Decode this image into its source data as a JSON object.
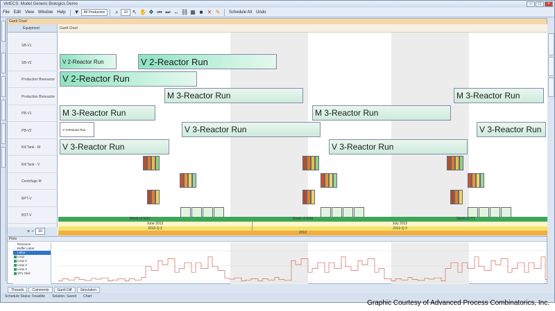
{
  "window": {
    "title": "VirtECS: Model Generic Biologics Demo"
  },
  "menu": {
    "items": [
      "File",
      "Edit",
      "View",
      "Window",
      "Help"
    ],
    "view_selector": "All Production",
    "zoom_value": "10",
    "schedule_label": "Schedule All",
    "undo_label": "Undo"
  },
  "left_tabs": [
    "Project",
    "Recipes",
    "Orders",
    "Models",
    "Data Sets",
    "Assumptions",
    "Scenarios",
    "Attribute Set"
  ],
  "right_tabs": [
    "History",
    "Tasks Detail",
    "Properties"
  ],
  "gantt": {
    "panel_title": "Gantt Chart",
    "equipment_header": "Equipment",
    "chart_header": "Gantt Chart",
    "equipment": [
      "SB-V1",
      "SB-V2",
      "Production Bioreactor",
      "Production Bioreactor",
      "PB-V1",
      "PB-V2",
      "Kill Tank - M",
      "Kill Tank - V",
      "Centrifuge M",
      "BPT-V",
      "BST-V"
    ],
    "bars": [
      {
        "label": "V 2-Reactor Run",
        "size": "small",
        "kind": "dark"
      },
      {
        "label": "V 2-Reactor Run",
        "size": "large",
        "kind": "dark"
      },
      {
        "label": "V 2-Reactor Run",
        "size": "large",
        "kind": "dark"
      },
      {
        "label": "M 3-Reactor Run",
        "size": "large",
        "kind": "light"
      },
      {
        "label": "M 3-Reactor Run",
        "size": "large",
        "kind": "light"
      },
      {
        "label": "M 3-Reactor Run",
        "size": "large",
        "kind": "light"
      },
      {
        "label": "M 3-Reactor Run",
        "size": "large",
        "kind": "light"
      },
      {
        "label": "V 3-Reactor Run",
        "size": "tiny",
        "kind": "white"
      },
      {
        "label": "V 3-Reactor Run",
        "size": "large",
        "kind": "light"
      },
      {
        "label": "V 3-Reactor Run",
        "size": "large",
        "kind": "light"
      },
      {
        "label": "V 3-Reactor Run",
        "size": "large",
        "kind": "light"
      },
      {
        "label": "V 3-Reactor Run",
        "size": "large",
        "kind": "light"
      }
    ],
    "controls": {
      "plus": "+",
      "minus": "−",
      "zoom": "10"
    }
  },
  "timeline": {
    "weeks": [
      "Week of 6/23",
      "Week of 6/30",
      "Week of 7/7"
    ],
    "months": [
      "June 2013",
      "July 2013"
    ],
    "quarters": [
      "2013 Q 2",
      "2013 Q 3"
    ],
    "year": "2013"
  },
  "plots": {
    "title": "Plots",
    "legend": [
      "Resource",
      "Buffer Labor",
      "Labor",
      "Loop",
      "Loop 2",
      "Loop 3",
      "Loop 4",
      "VP1 Skid"
    ],
    "selected": "Labor",
    "y_ticks": [
      "20",
      "10",
      "0"
    ],
    "ylabel": "Labor"
  },
  "bottom_tabs": [
    "Threads",
    "Comments",
    "Gantt Diff",
    "Simulation"
  ],
  "status": {
    "schedule_status": "Schedule Status: Feasible",
    "solution": "Solution: Saved",
    "chart": "Chart"
  },
  "credit": "Graphic Courtesy of Advanced Process Combinatorics, Inc.",
  "colors": {
    "accent_green": "#8ee3c0",
    "timeline_green": "#3fa55a",
    "timeline_yellow": "#f3e36b",
    "timeline_orange": "#f2ae46",
    "plot_line": "#d06a5a"
  }
}
